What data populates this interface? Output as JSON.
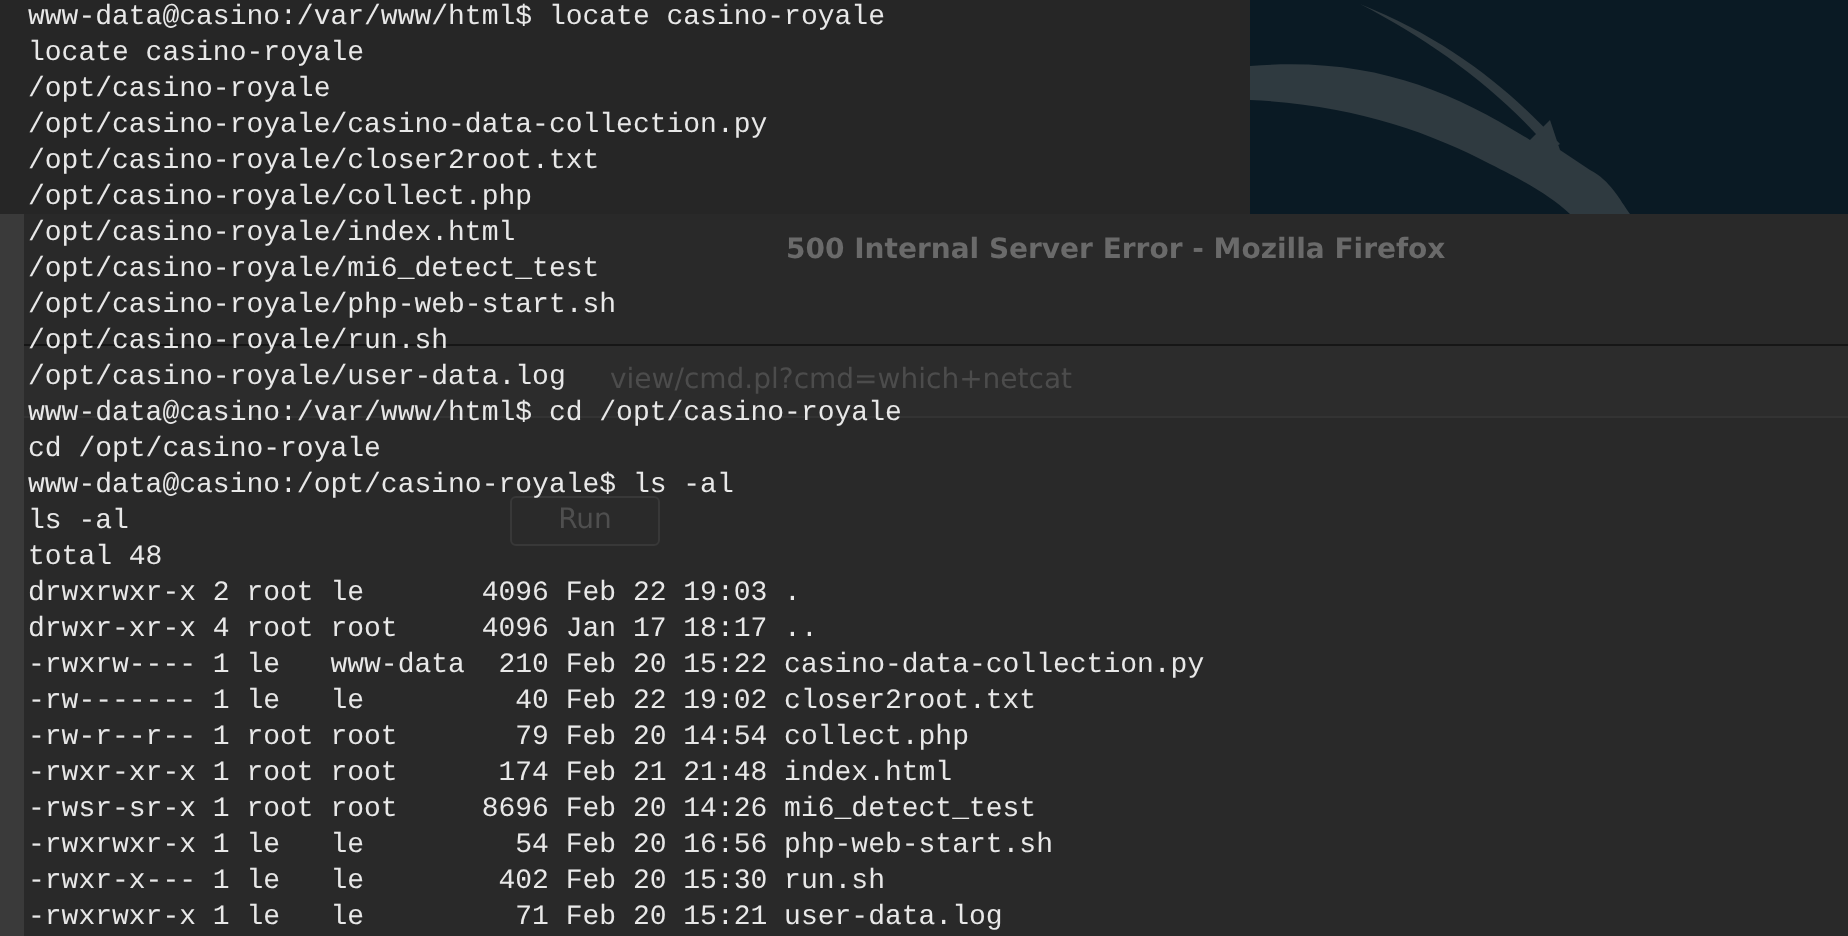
{
  "browser_window": {
    "title": "500 Internal Server Error - Mozilla Firefox",
    "url_fragment": "view/cmd.pl?cmd=which+netcat",
    "run_button": "Run"
  },
  "terminal": {
    "lines": [
      "www-data@casino:/var/www/html$ locate casino-royale",
      "locate casino-royale",
      "/opt/casino-royale",
      "/opt/casino-royale/casino-data-collection.py",
      "/opt/casino-royale/closer2root.txt",
      "/opt/casino-royale/collect.php",
      "/opt/casino-royale/index.html",
      "/opt/casino-royale/mi6_detect_test",
      "/opt/casino-royale/php-web-start.sh",
      "/opt/casino-royale/run.sh",
      "/opt/casino-royale/user-data.log",
      "www-data@casino:/var/www/html$ cd /opt/casino-royale",
      "cd /opt/casino-royale",
      "www-data@casino:/opt/casino-royale$ ls -al",
      "ls -al",
      "total 48",
      "drwxrwxr-x 2 root le       4096 Feb 22 19:03 .",
      "drwxr-xr-x 4 root root     4096 Jan 17 18:17 ..",
      "-rwxrw---- 1 le   www-data  210 Feb 20 15:22 casino-data-collection.py",
      "-rw------- 1 le   le         40 Feb 22 19:02 closer2root.txt",
      "-rw-r--r-- 1 root root       79 Feb 20 14:54 collect.php",
      "-rwxr-xr-x 1 root root      174 Feb 21 21:48 index.html",
      "-rwsr-sr-x 1 root root     8696 Feb 20 14:26 mi6_detect_test",
      "-rwxrwxr-x 1 le   le         54 Feb 20 16:56 php-web-start.sh",
      "-rwxr-x--- 1 le   le        402 Feb 20 15:30 run.sh",
      "-rwxrwxr-x 1 le   le         71 Feb 20 15:21 user-data.log"
    ]
  }
}
